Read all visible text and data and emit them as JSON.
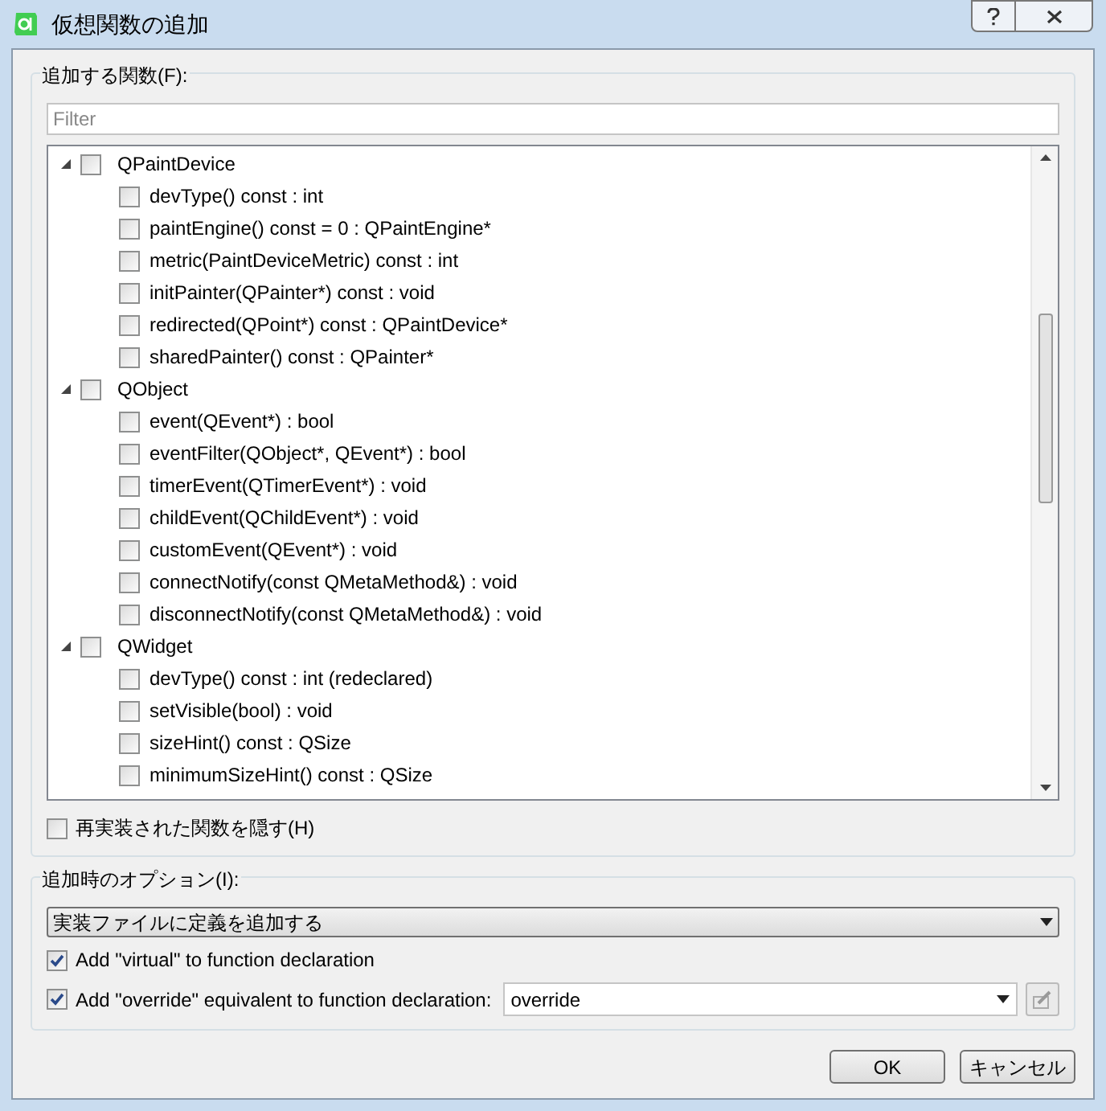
{
  "window": {
    "title": "仮想関数の追加"
  },
  "functions_group": {
    "label": "追加する関数(F):",
    "filter": {
      "placeholder": "Filter"
    },
    "tree": [
      {
        "label": "QPaintDevice",
        "expanded": true,
        "checked": false,
        "children": [
          {
            "label": "devType() const : int",
            "checked": false
          },
          {
            "label": "paintEngine() const = 0 : QPaintEngine*",
            "checked": false
          },
          {
            "label": "metric(PaintDeviceMetric) const : int",
            "checked": false
          },
          {
            "label": "initPainter(QPainter*) const : void",
            "checked": false
          },
          {
            "label": "redirected(QPoint*) const : QPaintDevice*",
            "checked": false
          },
          {
            "label": "sharedPainter() const : QPainter*",
            "checked": false
          }
        ]
      },
      {
        "label": "QObject",
        "expanded": true,
        "checked": false,
        "children": [
          {
            "label": "event(QEvent*) : bool",
            "checked": false
          },
          {
            "label": "eventFilter(QObject*, QEvent*) : bool",
            "checked": false
          },
          {
            "label": "timerEvent(QTimerEvent*) : void",
            "checked": false
          },
          {
            "label": "childEvent(QChildEvent*) : void",
            "checked": false
          },
          {
            "label": "customEvent(QEvent*) : void",
            "checked": false
          },
          {
            "label": "connectNotify(const QMetaMethod&) : void",
            "checked": false
          },
          {
            "label": "disconnectNotify(const QMetaMethod&) : void",
            "checked": false
          }
        ]
      },
      {
        "label": "QWidget",
        "expanded": true,
        "checked": false,
        "children": [
          {
            "label": "devType() const : int (redeclared)",
            "checked": false
          },
          {
            "label": "setVisible(bool) : void",
            "checked": false
          },
          {
            "label": "sizeHint() const : QSize",
            "checked": false
          },
          {
            "label": "minimumSizeHint() const : QSize",
            "checked": false
          }
        ]
      }
    ],
    "hide_reimplemented": {
      "label": "再実装された関数を隠す(H)",
      "checked": false
    }
  },
  "options_group": {
    "label": "追加時のオプション(I):",
    "insertion": {
      "value": "実装ファイルに定義を追加する"
    },
    "add_virtual": {
      "label": "Add \"virtual\" to function declaration",
      "checked": true
    },
    "add_override": {
      "label": "Add \"override\" equivalent to function declaration:",
      "checked": true,
      "value": "override"
    }
  },
  "buttons": [
    {
      "label": "OK"
    },
    {
      "label": "キャンセル"
    }
  ]
}
